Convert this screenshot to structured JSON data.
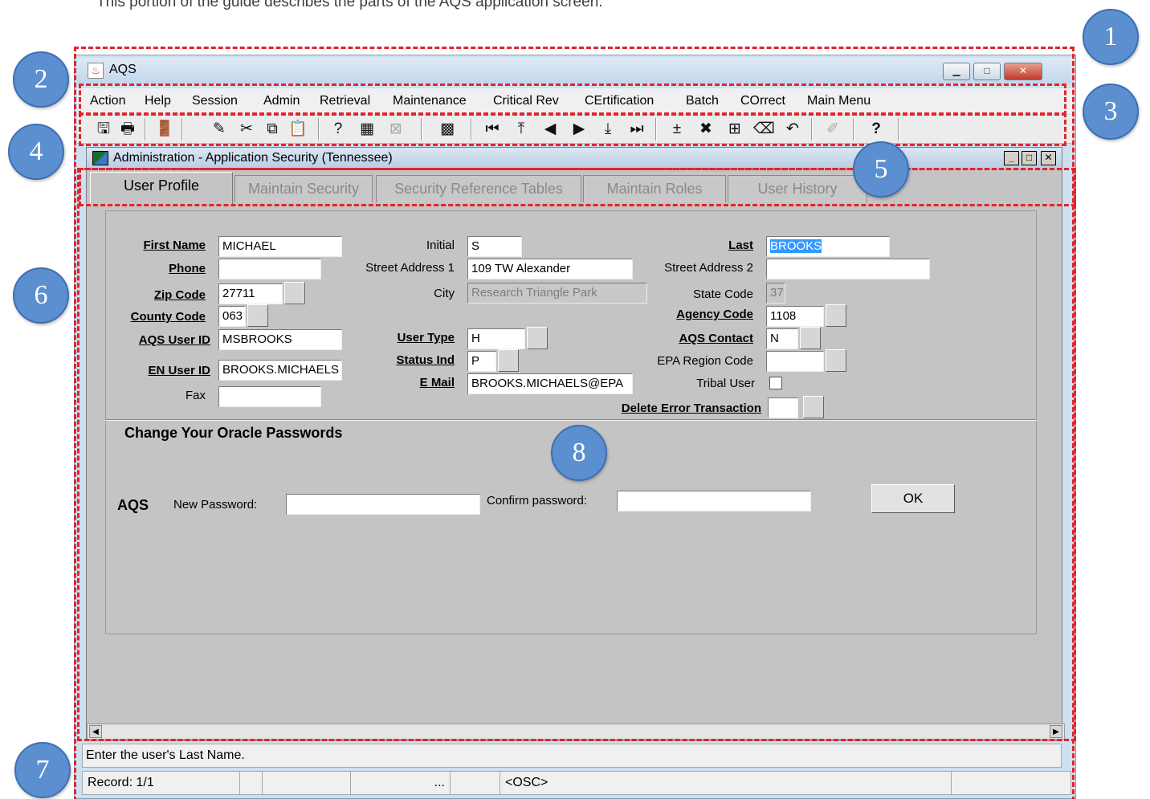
{
  "caption": "This portion of the guide describes the parts of the AQS application screen.",
  "window": {
    "title": "AQS",
    "minimize_glyph": "▁",
    "maximize_glyph": "□",
    "close_glyph": "✕"
  },
  "menu": [
    {
      "label": "Action"
    },
    {
      "label": "Help"
    },
    {
      "label": "Session"
    },
    {
      "label": "Admin"
    },
    {
      "label": "Retrieval"
    },
    {
      "label": "Maintenance"
    },
    {
      "label": "Critical Rev"
    },
    {
      "label": "CErtification"
    },
    {
      "label": "Batch"
    },
    {
      "label": "COrrect"
    },
    {
      "label": "Main Menu"
    }
  ],
  "toolbar": [
    {
      "icon": "save-icon",
      "glyph": "🖫"
    },
    {
      "icon": "print-icon",
      "glyph": "🖶"
    },
    {
      "icon": "exit-door-icon",
      "glyph": "🚪"
    },
    {
      "icon": "edit-pencil-icon",
      "glyph": "✎"
    },
    {
      "icon": "cut-scissors-icon",
      "glyph": "✂"
    },
    {
      "icon": "copy-icon",
      "glyph": "⧉"
    },
    {
      "icon": "paste-icon",
      "glyph": "📋"
    },
    {
      "icon": "query-icon",
      "glyph": "?"
    },
    {
      "icon": "execute-query-icon",
      "glyph": "▦"
    },
    {
      "icon": "cancel-query-icon",
      "glyph": "⊠"
    },
    {
      "icon": "calculator-icon",
      "glyph": "▩"
    },
    {
      "icon": "first-record-icon",
      "glyph": "⏮"
    },
    {
      "icon": "previous-block-icon",
      "glyph": "⤒"
    },
    {
      "icon": "previous-record-icon",
      "glyph": "◀"
    },
    {
      "icon": "next-record-icon",
      "glyph": "▶"
    },
    {
      "icon": "next-block-icon",
      "glyph": "⤓"
    },
    {
      "icon": "last-record-icon",
      "glyph": "⏭"
    },
    {
      "icon": "insert-record-icon",
      "glyph": "±"
    },
    {
      "icon": "delete-record-icon",
      "glyph": "✖"
    },
    {
      "icon": "duplicate-record-icon",
      "glyph": "⊞"
    },
    {
      "icon": "clear-record-icon",
      "glyph": "⌫"
    },
    {
      "icon": "undo-icon",
      "glyph": "↶"
    },
    {
      "icon": "edit-field-icon",
      "glyph": "✐"
    },
    {
      "icon": "help-icon",
      "glyph": "?"
    }
  ],
  "form": {
    "title": "Administration - Application Security (Tennessee)",
    "min_glyph": "_",
    "max_glyph": "□",
    "close_glyph": "✕"
  },
  "tabs": [
    {
      "label": "User Profile",
      "active": true
    },
    {
      "label": "Maintain Security",
      "active": false
    },
    {
      "label": "Security Reference Tables",
      "active": false
    },
    {
      "label": "Maintain Roles",
      "active": false
    },
    {
      "label": "User History",
      "active": false
    }
  ],
  "fields": {
    "first_name": {
      "label": "First Name",
      "value": "MICHAEL"
    },
    "initial": {
      "label": "Initial",
      "value": "S"
    },
    "last": {
      "label": "Last",
      "value": "BROOKS"
    },
    "phone": {
      "label": "Phone",
      "value": ""
    },
    "street1": {
      "label": "Street Address 1",
      "value": "109 TW Alexander"
    },
    "street2": {
      "label": "Street Address 2",
      "value": ""
    },
    "zip": {
      "label": "Zip Code",
      "value": "27711"
    },
    "city": {
      "label": "City",
      "value": "Research Triangle Park"
    },
    "state_code": {
      "label": "State Code",
      "value": "37"
    },
    "county_code": {
      "label": "County Code",
      "value": "063"
    },
    "agency_code": {
      "label": "Agency Code",
      "value": "1108"
    },
    "aqs_user_id": {
      "label": "AQS User ID",
      "value": "MSBROOKS"
    },
    "user_type": {
      "label": "User Type",
      "value": "H"
    },
    "aqs_contact": {
      "label": "AQS Contact",
      "value": "N"
    },
    "status_ind": {
      "label": "Status Ind",
      "value": "P"
    },
    "epa_region": {
      "label": "EPA Region Code",
      "value": ""
    },
    "en_user_id": {
      "label": "EN User ID",
      "value": "BROOKS.MICHAELS"
    },
    "email": {
      "label": "E Mail",
      "value": "BROOKS.MICHAELS@EPA"
    },
    "tribal_user": {
      "label": "Tribal User"
    },
    "fax": {
      "label": "Fax",
      "value": ""
    },
    "delete_error": {
      "label": "Delete Error Transaction",
      "value": ""
    }
  },
  "password": {
    "heading": "Change Your Oracle Passwords",
    "system": "AQS",
    "new_label": "New Password:",
    "confirm_label": "Confirm password:",
    "new_value": "",
    "confirm_value": "",
    "ok_label": "OK"
  },
  "scroll": {
    "left_glyph": "◀",
    "right_glyph": "▶"
  },
  "status": {
    "hint": "Enter the user's Last Name.",
    "record": "Record: 1/1",
    "ellipsis": "...",
    "mode": "<OSC>"
  },
  "callouts": [
    "1",
    "2",
    "3",
    "4",
    "5",
    "6",
    "7",
    "8"
  ],
  "colors": {
    "highlight": "#e3242b",
    "callout": "#5b8fd0",
    "selection": "#3399ff"
  }
}
